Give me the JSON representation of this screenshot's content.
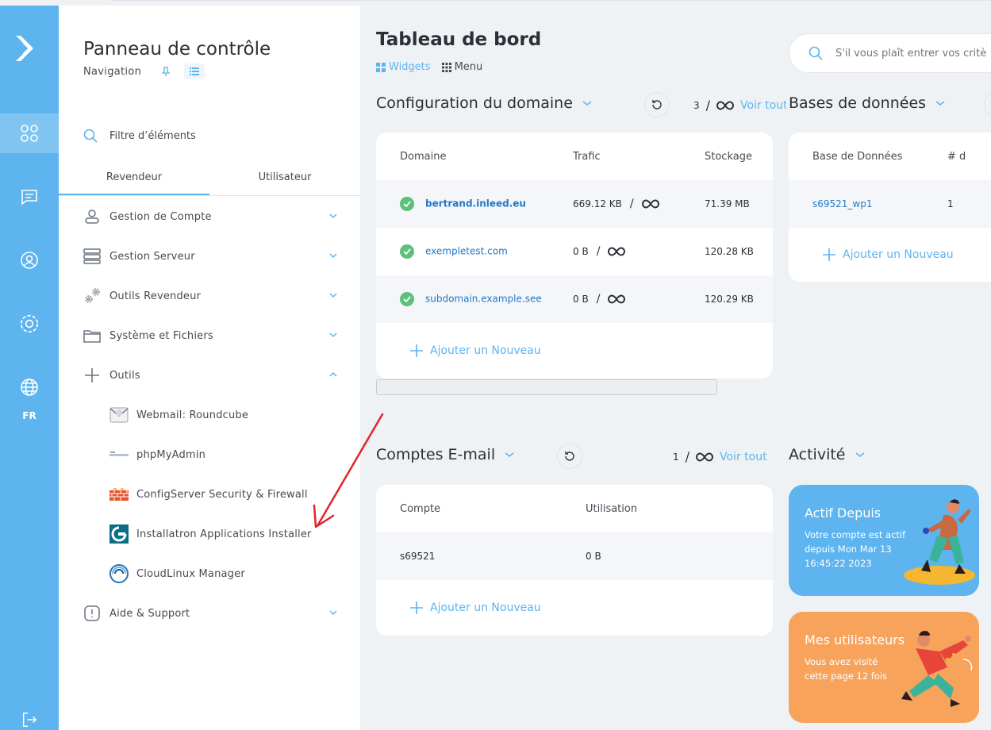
{
  "rail": {
    "language": "FR"
  },
  "sidebar": {
    "title": "Panneau de contrôle",
    "subtitle": "Navigation",
    "filter_placeholder": "Filtre d’éléments",
    "tabs": [
      "Revendeur",
      "Utilisateur"
    ],
    "items": [
      {
        "label": "Gestion de Compte"
      },
      {
        "label": "Gestion Serveur"
      },
      {
        "label": "Outils Revendeur"
      },
      {
        "label": "Système et Fichiers"
      },
      {
        "label": "Outils"
      },
      {
        "label": "Webmail: Roundcube"
      },
      {
        "label": "phpMyAdmin"
      },
      {
        "label": "ConfigServer Security & Firewall"
      },
      {
        "label": "Installatron Applications Installer"
      },
      {
        "label": "CloudLinux Manager"
      },
      {
        "label": "Aide & Support"
      }
    ]
  },
  "header": {
    "title": "Tableau de bord",
    "view_widgets": "Widgets",
    "view_menu": "Menu",
    "search_placeholder": "S'il vous plaît entrer vos critè"
  },
  "domains": {
    "title": "Configuration du domaine",
    "count": "3",
    "sep": "/",
    "view_all": "Voir tout",
    "columns": [
      "Domaine",
      "Trafic",
      "Stockage"
    ],
    "rows": [
      {
        "domain": "bertrand.inleed.eu",
        "traffic": "669.12 KB",
        "storage": "71.39 MB"
      },
      {
        "domain": "exempletest.com",
        "traffic": "0 B",
        "storage": "120.28 KB"
      },
      {
        "domain": "subdomain.example.see",
        "traffic": "0 B",
        "storage": "120.29 KB"
      }
    ],
    "add_new": "Ajouter un Nouveau",
    "traffic_sep": "/"
  },
  "databases": {
    "title": "Bases de données",
    "columns": [
      "Base de Données",
      "# d"
    ],
    "rows": [
      {
        "name": "s69521_wp1",
        "count": "1"
      }
    ],
    "add_new": "Ajouter un Nouveau"
  },
  "email": {
    "title": "Comptes E-mail",
    "count": "1",
    "sep": "/",
    "view_all": "Voir tout",
    "columns": [
      "Compte",
      "Utilisation"
    ],
    "rows": [
      {
        "account": "s69521",
        "usage": "0 B"
      }
    ],
    "add_new": "Ajouter un Nouveau"
  },
  "activity": {
    "title": "Activité",
    "card1": {
      "title": "Actif Depuis",
      "text": "Votre compte est actif depuis Mon Mar 13 16:45:22 2023",
      "color": "#5db4ee"
    },
    "card2": {
      "title": "Mes utilisateurs",
      "text": "Vous avez visité cette page 12 fois",
      "color": "#f7a35c"
    }
  },
  "colors": {
    "accent": "#5db4ee",
    "link": "#2379c7",
    "annotation_arrow": "#e0242b"
  }
}
